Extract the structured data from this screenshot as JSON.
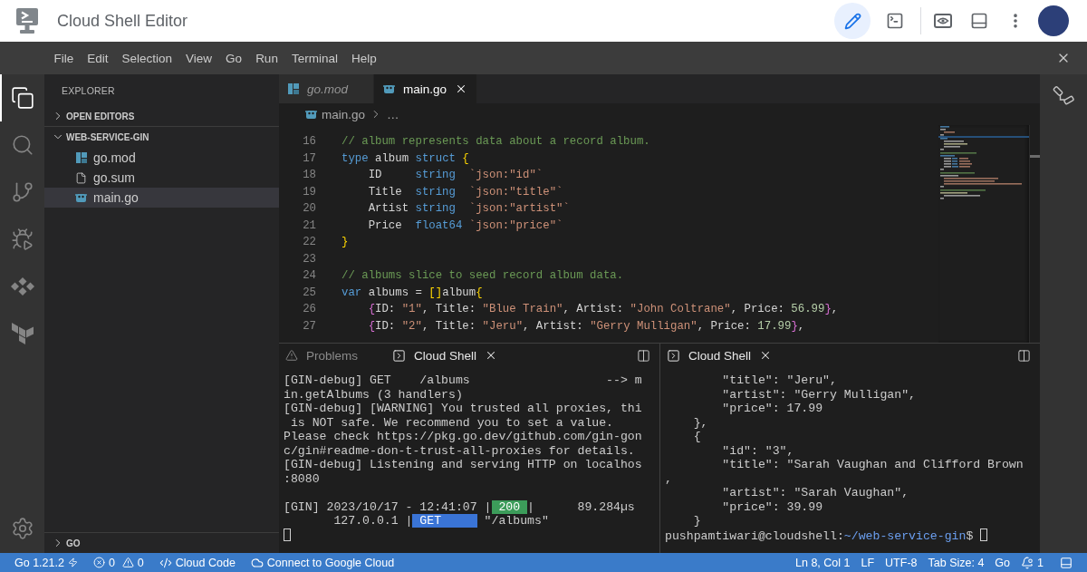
{
  "header": {
    "title": "Cloud Shell Editor",
    "modes": [
      {
        "kind": "editor",
        "selected": true
      },
      {
        "kind": "terminal",
        "selected": false
      }
    ]
  },
  "menu": [
    "File",
    "Edit",
    "Selection",
    "View",
    "Go",
    "Run",
    "Terminal",
    "Help"
  ],
  "activity_bar": [
    {
      "kind": "explorer",
      "selected": true
    },
    {
      "kind": "search",
      "selected": false
    },
    {
      "kind": "source_control",
      "selected": false
    },
    {
      "kind": "debug",
      "selected": false
    },
    {
      "kind": "diamonds",
      "selected": false
    },
    {
      "kind": "blocks",
      "selected": false
    }
  ],
  "explorer": {
    "title": "EXPLORER",
    "sections": [
      {
        "label": "OPEN EDITORS",
        "expanded": false
      },
      {
        "label": "WEB-SERVICE-GIN",
        "expanded": true,
        "children": [
          {
            "label": "go.mod",
            "kind": "module",
            "selected": false
          },
          {
            "label": "go.sum",
            "kind": "text",
            "selected": false
          },
          {
            "label": "main.go",
            "kind": "go",
            "selected": true
          }
        ]
      },
      {
        "label": "GO",
        "expanded": false
      }
    ]
  },
  "editor": {
    "tabs": [
      {
        "label": "go.mod",
        "kind": "module",
        "selected": false,
        "preview": true
      },
      {
        "label": "main.go",
        "kind": "go",
        "selected": true,
        "preview": false
      }
    ],
    "breadcrumb": [
      {
        "kind": "go",
        "label": "main.go"
      },
      {
        "kind": "more",
        "label": "…"
      }
    ],
    "lines": [
      {
        "number": "16",
        "tokens": [
          {
            "kind": "comment",
            "text": "// album represents data about a record album."
          }
        ]
      },
      {
        "number": "17",
        "tokens": [
          {
            "kind": "keyword",
            "text": "type"
          },
          {
            "kind": "plain",
            "text": " album "
          },
          {
            "kind": "keyword",
            "text": "struct"
          },
          {
            "kind": "bracket",
            "text": " {"
          }
        ]
      },
      {
        "number": "18",
        "tokens": [
          {
            "kind": "plain",
            "text": "    ID     "
          },
          {
            "kind": "keyword",
            "text": "string"
          },
          {
            "kind": "string",
            "text": "  `json:\"id\"`"
          }
        ]
      },
      {
        "number": "19",
        "tokens": [
          {
            "kind": "plain",
            "text": "    Title  "
          },
          {
            "kind": "keyword",
            "text": "string"
          },
          {
            "kind": "string",
            "text": "  `json:\"title\"`"
          }
        ]
      },
      {
        "number": "20",
        "tokens": [
          {
            "kind": "plain",
            "text": "    Artist "
          },
          {
            "kind": "keyword",
            "text": "string"
          },
          {
            "kind": "string",
            "text": "  `json:\"artist\"`"
          }
        ]
      },
      {
        "number": "21",
        "tokens": [
          {
            "kind": "plain",
            "text": "    Price  "
          },
          {
            "kind": "keyword",
            "text": "float64"
          },
          {
            "kind": "string",
            "text": " `json:\"price\"`"
          }
        ]
      },
      {
        "number": "22",
        "tokens": [
          {
            "kind": "bracket",
            "text": "}"
          }
        ]
      },
      {
        "number": "23"
      },
      {
        "number": "24",
        "tokens": [
          {
            "kind": "comment",
            "text": "// albums slice to seed record album data."
          }
        ]
      },
      {
        "number": "25",
        "tokens": [
          {
            "kind": "keyword",
            "text": "var"
          },
          {
            "kind": "plain",
            "text": " albums = "
          },
          {
            "kind": "bracket",
            "text": "[]"
          },
          {
            "kind": "plain",
            "text": "album"
          },
          {
            "kind": "bracket",
            "text": "{"
          }
        ]
      },
      {
        "number": "26",
        "tokens": [
          {
            "kind": "bracket2",
            "text": "    {"
          },
          {
            "kind": "plain",
            "text": "ID: "
          },
          {
            "kind": "string",
            "text": "\"1\""
          },
          {
            "kind": "plain",
            "text": ", Title: "
          },
          {
            "kind": "string",
            "text": "\"Blue Train\""
          },
          {
            "kind": "plain",
            "text": ", Artist: "
          },
          {
            "kind": "string",
            "text": "\"John Coltrane\""
          },
          {
            "kind": "plain",
            "text": ", Price: "
          },
          {
            "kind": "number",
            "text": "56.99"
          },
          {
            "kind": "bracket2",
            "text": "}"
          },
          {
            "kind": "plain",
            "text": ","
          }
        ]
      },
      {
        "number": "27",
        "tokens": [
          {
            "kind": "bracket2",
            "text": "    {"
          },
          {
            "kind": "plain",
            "text": "ID: "
          },
          {
            "kind": "string",
            "text": "\"2\""
          },
          {
            "kind": "plain",
            "text": ", Title: "
          },
          {
            "kind": "string",
            "text": "\"Jeru\""
          },
          {
            "kind": "plain",
            "text": ", Artist: "
          },
          {
            "kind": "string",
            "text": "\"Gerry Mulligan\""
          },
          {
            "kind": "plain",
            "text": ", Price: "
          },
          {
            "kind": "number",
            "text": "17.99"
          },
          {
            "kind": "bracket2",
            "text": "}"
          },
          {
            "kind": "plain",
            "text": ","
          }
        ]
      }
    ]
  },
  "panel": {
    "groups": [
      {
        "tabs": [
          {
            "kind": "problems",
            "label": "Problems",
            "selected": false
          },
          {
            "kind": "terminal",
            "label": "Cloud Shell",
            "selected": true
          }
        ],
        "lines": [
          {
            "kind": "text",
            "segments": [
              {
                "kind": "plain",
                "text": "[GIN-debug] GET    /albums                   --> m"
              }
            ]
          },
          {
            "kind": "text",
            "segments": [
              {
                "kind": "plain",
                "text": "in.getAlbums (3 handlers)"
              }
            ]
          },
          {
            "kind": "text",
            "segments": [
              {
                "kind": "plain",
                "text": "[GIN-debug] [WARNING] You trusted all proxies, thi"
              }
            ]
          },
          {
            "kind": "text",
            "segments": [
              {
                "kind": "plain",
                "text": " is NOT safe. We recommend you to set a value."
              }
            ]
          },
          {
            "kind": "text",
            "segments": [
              {
                "kind": "plain",
                "text": "Please check https://pkg.go.dev/github.com/gin-gon"
              }
            ]
          },
          {
            "kind": "text",
            "segments": [
              {
                "kind": "plain",
                "text": "c/gin#readme-don-t-trust-all-proxies for details."
              }
            ]
          },
          {
            "kind": "text",
            "segments": [
              {
                "kind": "plain",
                "text": "[GIN-debug] Listening and serving HTTP on localhos"
              }
            ]
          },
          {
            "kind": "text",
            "segments": [
              {
                "kind": "plain",
                "text": ":8080"
              }
            ]
          },
          {
            "kind": "blank"
          },
          {
            "kind": "text",
            "segments": [
              {
                "kind": "plain",
                "text": "[GIN] 2023/10/17 - 12:41:07 |"
              },
              {
                "kind": "highlight",
                "color": "#3c9c5a",
                "text": " 200 "
              },
              {
                "kind": "plain",
                "text": "|      89.284µs"
              }
            ]
          },
          {
            "kind": "text",
            "segments": [
              {
                "kind": "plain",
                "text": "       127.0.0.1 |"
              },
              {
                "kind": "highlight",
                "color": "#3a74d6",
                "text": " GET     "
              },
              {
                "kind": "plain",
                "text": " \"/albums\""
              }
            ]
          },
          {
            "kind": "text",
            "segments": [
              {
                "kind": "cursor"
              }
            ]
          }
        ]
      },
      {
        "tabs": [
          {
            "kind": "terminal",
            "label": "Cloud Shell",
            "selected": true
          }
        ],
        "lines": [
          {
            "kind": "text",
            "segments": [
              {
                "kind": "plain",
                "text": "        \"title\": \"Jeru\","
              }
            ]
          },
          {
            "kind": "text",
            "segments": [
              {
                "kind": "plain",
                "text": "        \"artist\": \"Gerry Mulligan\","
              }
            ]
          },
          {
            "kind": "text",
            "segments": [
              {
                "kind": "plain",
                "text": "        \"price\": 17.99"
              }
            ]
          },
          {
            "kind": "text",
            "segments": [
              {
                "kind": "plain",
                "text": "    },"
              }
            ]
          },
          {
            "kind": "text",
            "segments": [
              {
                "kind": "plain",
                "text": "    {"
              }
            ]
          },
          {
            "kind": "text",
            "segments": [
              {
                "kind": "plain",
                "text": "        \"id\": \"3\","
              }
            ]
          },
          {
            "kind": "text",
            "segments": [
              {
                "kind": "plain",
                "text": "        \"title\": \"Sarah Vaughan and Clifford Brown"
              }
            ]
          },
          {
            "kind": "text",
            "segments": [
              {
                "kind": "plain",
                "text": ","
              }
            ]
          },
          {
            "kind": "text",
            "segments": [
              {
                "kind": "plain",
                "text": "        \"artist\": \"Sarah Vaughan\","
              }
            ]
          },
          {
            "kind": "text",
            "segments": [
              {
                "kind": "plain",
                "text": "        \"price\": 39.99"
              }
            ]
          },
          {
            "kind": "text",
            "segments": [
              {
                "kind": "plain",
                "text": "    }"
              }
            ]
          },
          {
            "kind": "text",
            "segments": [
              {
                "kind": "plain",
                "text": "pushpamtiwari@cloudshell:"
              },
              {
                "kind": "path",
                "text": "~/web-service-gin"
              },
              {
                "kind": "plain",
                "text": "$"
              },
              {
                "kind": "cursor"
              }
            ]
          }
        ]
      }
    ]
  },
  "status_bar": {
    "left": [
      {
        "kind": "version",
        "label": "Go 1.21.2"
      },
      {
        "kind": "problems",
        "errors": "0",
        "warnings": "0"
      },
      {
        "kind": "code",
        "label": "Cloud Code"
      },
      {
        "kind": "cloud",
        "label": "Connect to Google Cloud"
      }
    ],
    "right": [
      {
        "kind": "text",
        "label": "Ln 8, Col 1"
      },
      {
        "kind": "text",
        "label": "LF"
      },
      {
        "kind": "text",
        "label": "UTF-8"
      },
      {
        "kind": "text",
        "label": "Tab Size: 4"
      },
      {
        "kind": "text",
        "label": "Go"
      },
      {
        "kind": "notifications",
        "label": "1"
      }
    ]
  }
}
